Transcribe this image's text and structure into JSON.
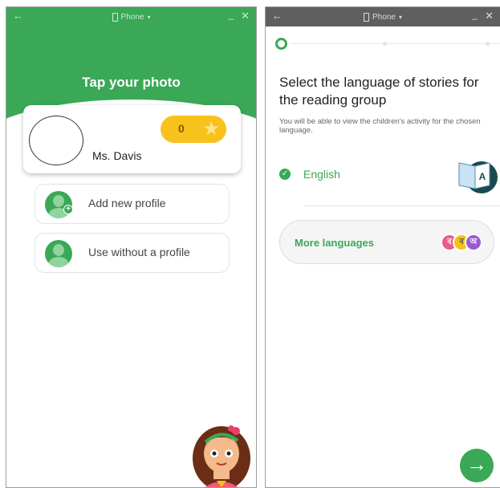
{
  "window": {
    "title": "Phone",
    "back_glyph": "←",
    "dropdown_glyph": "▾",
    "minimize_glyph": "_",
    "close_glyph": "✕"
  },
  "profile_screen": {
    "title": "Tap your photo",
    "profile": {
      "name": "Ms. Davis",
      "stars": "0"
    },
    "options": [
      {
        "label": "Add new profile",
        "icon": "add-user-icon"
      },
      {
        "label": "Use without a profile",
        "icon": "user-icon"
      }
    ],
    "colors": {
      "accent": "#3aa856",
      "star_pill": "#f8c21d"
    }
  },
  "language_screen": {
    "heading": "Select the language of stories for the reading group",
    "subtext": "You will be able to view the children's activity for the chosen language.",
    "selected_language": "English",
    "more_languages_label": "More languages",
    "book_letter": "A",
    "script_samples": [
      "ব",
      "ব",
      "অ"
    ],
    "progress": {
      "current_step": 1,
      "total_steps": 3
    },
    "next_glyph": "→",
    "check_glyph": "✓"
  }
}
